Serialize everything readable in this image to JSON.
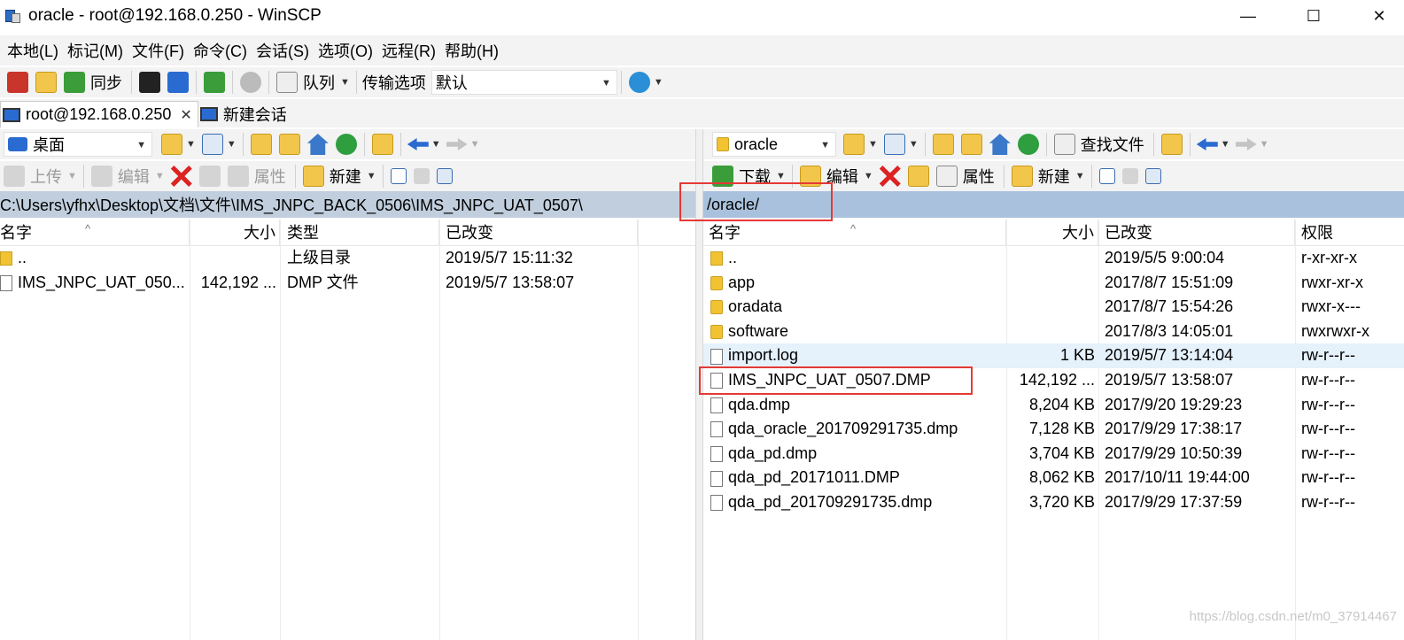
{
  "window": {
    "title": "oracle - root@192.168.0.250 - WinSCP",
    "minimize": "—",
    "maximize": "☐",
    "close": "✕"
  },
  "menu": [
    "本地(L)",
    "标记(M)",
    "文件(F)",
    "命令(C)",
    "会话(S)",
    "选项(O)",
    "远程(R)",
    "帮助(H)"
  ],
  "toolbar": {
    "sync_label": "同步",
    "queue_label": "队列",
    "transfer_options_label": "传输选项",
    "transfer_preset": "默认"
  },
  "tabs": {
    "session": "root@192.168.0.250",
    "new_session": "新建会话"
  },
  "left": {
    "drive": "桌面",
    "upload": "上传",
    "edit": "编辑",
    "properties": "属性",
    "new": "新建",
    "path": "C:\\Users\\yfhx\\Desktop\\文档\\文件\\IMS_JNPC_BACK_0506\\IMS_JNPC_UAT_0507\\",
    "columns": [
      "名字",
      "大小",
      "类型",
      "已改变"
    ],
    "rows": [
      {
        "name": "..",
        "size": "",
        "type": "上级目录",
        "changed": "2019/5/7  15:11:32",
        "icon": "parent-dir-icon"
      },
      {
        "name": "IMS_JNPC_UAT_050...",
        "size": "142,192 ...",
        "type": "DMP 文件",
        "changed": "2019/5/7  13:58:07",
        "icon": "file-icon"
      }
    ]
  },
  "right": {
    "dir": "oracle",
    "find_files": "查找文件",
    "download": "下载",
    "edit": "编辑",
    "properties": "属性",
    "new": "新建",
    "path": "/oracle/",
    "columns": [
      "名字",
      "大小",
      "已改变",
      "权限"
    ],
    "rows": [
      {
        "name": "..",
        "size": "",
        "changed": "2019/5/5 9:00:04",
        "rights": "r-xr-xr-x",
        "icon": "parent-dir-icon"
      },
      {
        "name": "app",
        "size": "",
        "changed": "2017/8/7 15:51:09",
        "rights": "rwxr-xr-x",
        "icon": "folder-icon"
      },
      {
        "name": "oradata",
        "size": "",
        "changed": "2017/8/7 15:54:26",
        "rights": "rwxr-x---",
        "icon": "folder-icon"
      },
      {
        "name": "software",
        "size": "",
        "changed": "2017/8/3 14:05:01",
        "rights": "rwxrwxr-x",
        "icon": "folder-icon"
      },
      {
        "name": "import.log",
        "size": "1 KB",
        "changed": "2019/5/7 13:14:04",
        "rights": "rw-r--r--",
        "icon": "file-icon"
      },
      {
        "name": "IMS_JNPC_UAT_0507.DMP",
        "size": "142,192 ...",
        "changed": "2019/5/7 13:58:07",
        "rights": "rw-r--r--",
        "icon": "file-icon"
      },
      {
        "name": "qda.dmp",
        "size": "8,204 KB",
        "changed": "2017/9/20 19:29:23",
        "rights": "rw-r--r--",
        "icon": "file-icon"
      },
      {
        "name": "qda_oracle_201709291735.dmp",
        "size": "7,128 KB",
        "changed": "2017/9/29 17:38:17",
        "rights": "rw-r--r--",
        "icon": "file-icon"
      },
      {
        "name": "qda_pd.dmp",
        "size": "3,704 KB",
        "changed": "2017/9/29 10:50:39",
        "rights": "rw-r--r--",
        "icon": "file-icon"
      },
      {
        "name": "qda_pd_20171011.DMP",
        "size": "8,062 KB",
        "changed": "2017/10/11 19:44:00",
        "rights": "rw-r--r--",
        "icon": "file-icon"
      },
      {
        "name": "qda_pd_201709291735.dmp",
        "size": "3,720 KB",
        "changed": "2017/9/29 17:37:59",
        "rights": "rw-r--r--",
        "icon": "file-icon"
      }
    ]
  },
  "watermark": "https://blog.csdn.net/m0_37914467",
  "colors": {
    "highlight_box": "#e53935",
    "left_path_bg": "#c0cedd",
    "right_path_bg": "#a9c1dc"
  }
}
